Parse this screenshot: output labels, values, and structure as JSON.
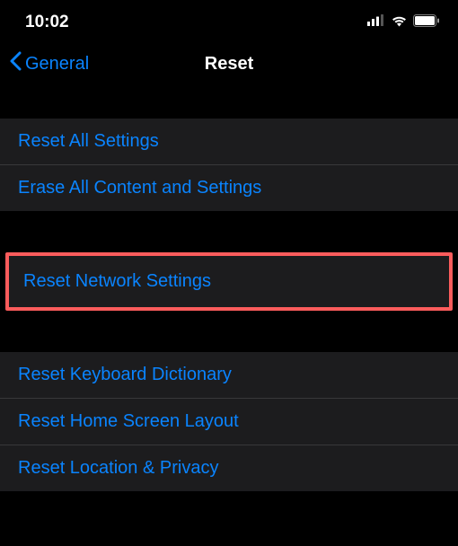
{
  "status": {
    "time": "10:02"
  },
  "nav": {
    "back_label": "General",
    "title": "Reset"
  },
  "group1": {
    "items": [
      "Reset All Settings",
      "Erase All Content and Settings"
    ]
  },
  "highlighted": {
    "label": "Reset Network Settings"
  },
  "group2": {
    "items": [
      "Reset Keyboard Dictionary",
      "Reset Home Screen Layout",
      "Reset Location & Privacy"
    ]
  }
}
